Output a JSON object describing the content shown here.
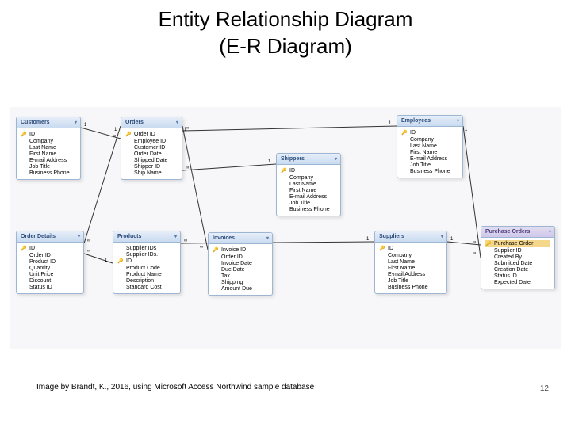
{
  "title_line1": "Entity Relationship Diagram",
  "title_line2": "(E-R Diagram)",
  "credit": "Image by Brandt, K., 2016, using Microsoft Access Northwind sample database",
  "page_number": "12",
  "tables": {
    "customers": {
      "name": "Customers",
      "fields": [
        "ID",
        "Company",
        "Last Name",
        "First Name",
        "E-mail Address",
        "Job Title",
        "Business Phone"
      ]
    },
    "orders": {
      "name": "Orders",
      "fields": [
        "Order ID",
        "Employee ID",
        "Customer ID",
        "Order Date",
        "Shipped Date",
        "Shipper ID",
        "Ship Name"
      ]
    },
    "shippers": {
      "name": "Shippers",
      "fields": [
        "ID",
        "Company",
        "Last Name",
        "First Name",
        "E-mail Address",
        "Job Title",
        "Business Phone"
      ]
    },
    "employees": {
      "name": "Employees",
      "fields": [
        "ID",
        "Company",
        "Last Name",
        "First Name",
        "E-mail Address",
        "Job Title",
        "Business Phone"
      ]
    },
    "order_details": {
      "name": "Order Details",
      "fields": [
        "ID",
        "Order ID",
        "Product ID",
        "Quantity",
        "Unit Price",
        "Discount",
        "Status ID"
      ]
    },
    "products": {
      "name": "Products",
      "fields": [
        "Supplier IDs",
        "Supplier IDs.",
        "ID",
        "Product Code",
        "Product Name",
        "Description",
        "Standard Cost"
      ]
    },
    "invoices": {
      "name": "Invoices",
      "fields": [
        "Invoice ID",
        "Order ID",
        "Invoice Date",
        "Due Date",
        "Tax",
        "Shipping",
        "Amount Due"
      ]
    },
    "suppliers": {
      "name": "Suppliers",
      "fields": [
        "ID",
        "Company",
        "Last Name",
        "First Name",
        "E-mail Address",
        "Job Title",
        "Business Phone"
      ]
    },
    "purchase_orders": {
      "name": "Purchase Orders",
      "hl_field": "Purchase Order",
      "fields": [
        "Supplier ID",
        "Created By",
        "Submitted Date",
        "Creation Date",
        "Status ID",
        "Expected Date"
      ]
    }
  },
  "card_one": "1",
  "card_many": "∞"
}
